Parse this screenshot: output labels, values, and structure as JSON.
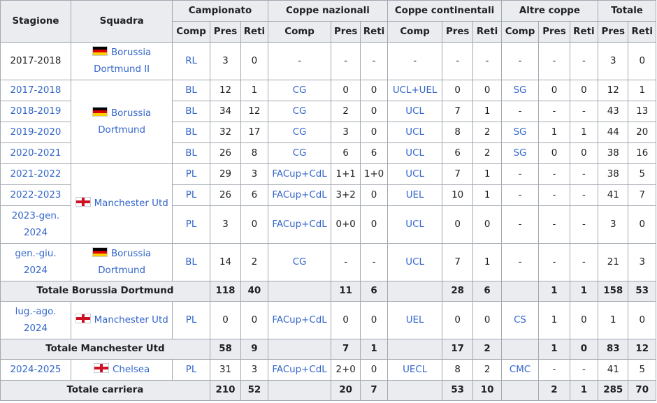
{
  "headers": {
    "stagione": "Stagione",
    "squadra": "Squadra",
    "campionato": "Campionato",
    "coppe_nazionali": "Coppe nazionali",
    "coppe_continentali": "Coppe continentali",
    "altre_coppe": "Altre coppe",
    "totale": "Totale",
    "comp": "Comp",
    "pres": "Pres",
    "reti": "Reti"
  },
  "teams": {
    "bvb2": {
      "name": "Borussia Dortmund II",
      "flag": "germany-flag"
    },
    "bvb": {
      "name": "Borussia Dortmund",
      "flag": "germany-flag"
    },
    "mu": {
      "name": "Manchester Utd",
      "flag": "england-flag"
    },
    "chelsea": {
      "name": "Chelsea",
      "flag": "england-flag"
    }
  },
  "rows": [
    {
      "season": "2017-2018",
      "lc": "RL",
      "lp": "3",
      "lr": "0",
      "nc": "-",
      "np": "-",
      "nr": "-",
      "cc": "-",
      "cp": "-",
      "cr": "-",
      "oc": "-",
      "op": "-",
      "or": "-",
      "tp": "3",
      "tr": "0"
    },
    {
      "season": "2017-2018",
      "lc": "BL",
      "lp": "12",
      "lr": "1",
      "nc": "CG",
      "np": "0",
      "nr": "0",
      "cc": "UCL+UEL",
      "cp": "0",
      "cr": "0",
      "oc": "SG",
      "op": "0",
      "or": "0",
      "tp": "12",
      "tr": "1"
    },
    {
      "season": "2018-2019",
      "lc": "BL",
      "lp": "34",
      "lr": "12",
      "nc": "CG",
      "np": "2",
      "nr": "0",
      "cc": "UCL",
      "cp": "7",
      "cr": "1",
      "oc": "-",
      "op": "-",
      "or": "-",
      "tp": "43",
      "tr": "13"
    },
    {
      "season": "2019-2020",
      "lc": "BL",
      "lp": "32",
      "lr": "17",
      "nc": "CG",
      "np": "3",
      "nr": "0",
      "cc": "UCL",
      "cp": "8",
      "cr": "2",
      "oc": "SG",
      "op": "1",
      "or": "1",
      "tp": "44",
      "tr": "20"
    },
    {
      "season": "2020-2021",
      "lc": "BL",
      "lp": "26",
      "lr": "8",
      "nc": "CG",
      "np": "6",
      "nr": "6",
      "cc": "UCL",
      "cp": "6",
      "cr": "2",
      "oc": "SG",
      "op": "0",
      "or": "0",
      "tp": "38",
      "tr": "16"
    },
    {
      "season": "2021-2022",
      "lc": "PL",
      "lp": "29",
      "lr": "3",
      "nc": "FACup+CdL",
      "np": "1+1",
      "nr": "1+0",
      "cc": "UCL",
      "cp": "7",
      "cr": "1",
      "oc": "-",
      "op": "-",
      "or": "-",
      "tp": "38",
      "tr": "5"
    },
    {
      "season": "2022-2023",
      "lc": "PL",
      "lp": "26",
      "lr": "6",
      "nc": "FACup+CdL",
      "np": "3+2",
      "nr": "0",
      "cc": "UEL",
      "cp": "10",
      "cr": "1",
      "oc": "-",
      "op": "-",
      "or": "-",
      "tp": "41",
      "tr": "7"
    },
    {
      "season": "2023-gen. 2024",
      "lc": "PL",
      "lp": "3",
      "lr": "0",
      "nc": "FACup+CdL",
      "np": "0+0",
      "nr": "0",
      "cc": "UCL",
      "cp": "0",
      "cr": "0",
      "oc": "-",
      "op": "-",
      "or": "-",
      "tp": "3",
      "tr": "0"
    },
    {
      "season": "gen.-giu. 2024",
      "lc": "BL",
      "lp": "14",
      "lr": "2",
      "nc": "CG",
      "np": "-",
      "nr": "-",
      "cc": "UCL",
      "cp": "7",
      "cr": "1",
      "oc": "-",
      "op": "-",
      "or": "-",
      "tp": "21",
      "tr": "3"
    },
    {
      "season": "lug.-ago. 2024",
      "lc": "PL",
      "lp": "0",
      "lr": "0",
      "nc": "FACup+CdL",
      "np": "0",
      "nr": "0",
      "cc": "UEL",
      "cp": "0",
      "cr": "0",
      "oc": "CS",
      "op": "1",
      "or": "0",
      "tp": "1",
      "tr": "0"
    },
    {
      "season": "2024-2025",
      "lc": "PL",
      "lp": "31",
      "lr": "3",
      "nc": "FACup+CdL",
      "np": "2+0",
      "nr": "0",
      "cc": "UECL",
      "cp": "8",
      "cr": "2",
      "oc": "CMC",
      "op": "-",
      "or": "-",
      "tp": "41",
      "tr": "5"
    }
  ],
  "totals": {
    "bvb": {
      "label": "Totale Borussia Dortmund",
      "lp": "118",
      "lr": "40",
      "np": "11",
      "nr": "6",
      "cp": "28",
      "cr": "6",
      "op": "1",
      "or": "1",
      "tp": "158",
      "tr": "53"
    },
    "mu": {
      "label": "Totale Manchester Utd",
      "lp": "58",
      "lr": "9",
      "np": "7",
      "nr": "1",
      "cp": "17",
      "cr": "2",
      "op": "1",
      "or": "0",
      "tp": "83",
      "tr": "12"
    },
    "career": {
      "label": "Totale carriera",
      "lp": "210",
      "lr": "52",
      "np": "20",
      "nr": "7",
      "cp": "53",
      "cr": "10",
      "op": "2",
      "or": "1",
      "tp": "285",
      "tr": "70"
    }
  },
  "colors": {
    "link": "#3366cc",
    "header_bg": "#eaecf0",
    "border": "#a2a9b1",
    "text": "#202122"
  }
}
